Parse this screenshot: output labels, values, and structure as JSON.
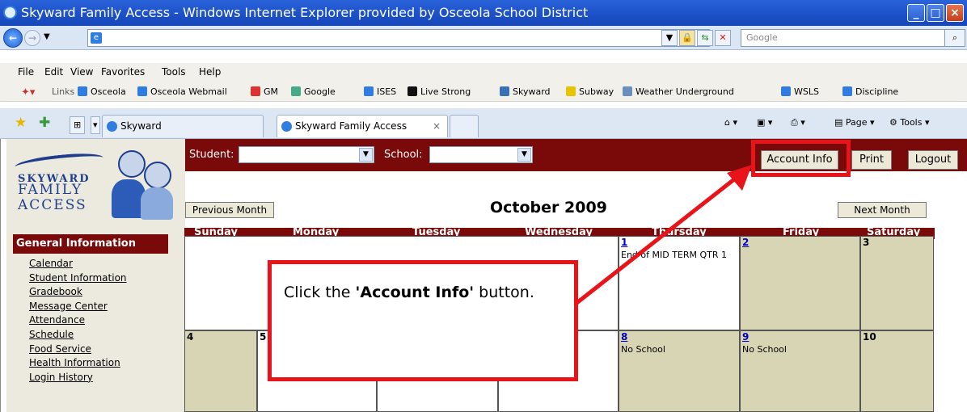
{
  "window": {
    "title": "Skyward Family Access - Windows Internet Explorer provided by Osceola School District"
  },
  "addressbar": {
    "search_placeholder": "Google"
  },
  "menu": [
    "File",
    "Edit",
    "View",
    "Favorites",
    "Tools",
    "Help"
  ],
  "links": {
    "label": "Links",
    "items": [
      "Osceola",
      "Osceola Webmail",
      "GM",
      "Google",
      "ISES",
      "Live Strong",
      "Skyward",
      "Subway",
      "Weather Underground",
      "WSLS",
      "Discipline"
    ]
  },
  "tabs": [
    "Skyward",
    "Skyward Family Access"
  ],
  "commandbar": {
    "page": "Page",
    "tools": "Tools"
  },
  "app": {
    "logo_text": [
      "SKYWARD",
      "FAMILY",
      "ACCESS"
    ],
    "student_label": "Student:",
    "school_label": "School:",
    "account_info": "Account Info",
    "print": "Print",
    "logout": "Logout",
    "nav_header": "General Information",
    "nav": [
      "Calendar",
      "Student Information",
      "Gradebook",
      "Message Center",
      "Attendance",
      "Schedule",
      "Food Service",
      "Health Information",
      "Login History"
    ]
  },
  "calendar": {
    "title": "October 2009",
    "prev": "Previous Month",
    "next": "Next Month",
    "days": [
      "Sunday",
      "Monday",
      "Tuesday",
      "Wednesday",
      "Thursday",
      "Friday",
      "Saturday"
    ],
    "cells": {
      "d1": "1",
      "d1_note": "End of MID TERM QTR 1",
      "d2": "2",
      "d3": "3",
      "d4": "4",
      "d5": "5",
      "d8": "8",
      "d8_note": "No School",
      "d9": "9",
      "d9_note": "No School",
      "d10": "10"
    }
  },
  "callout": {
    "prefix": "Click the ",
    "bold": "'Account Info'",
    "suffix": " button."
  },
  "colors": {
    "accent_red": "#e8141a",
    "header_maroon": "#7a0a0a",
    "cell_tan": "#d7d5b4"
  }
}
